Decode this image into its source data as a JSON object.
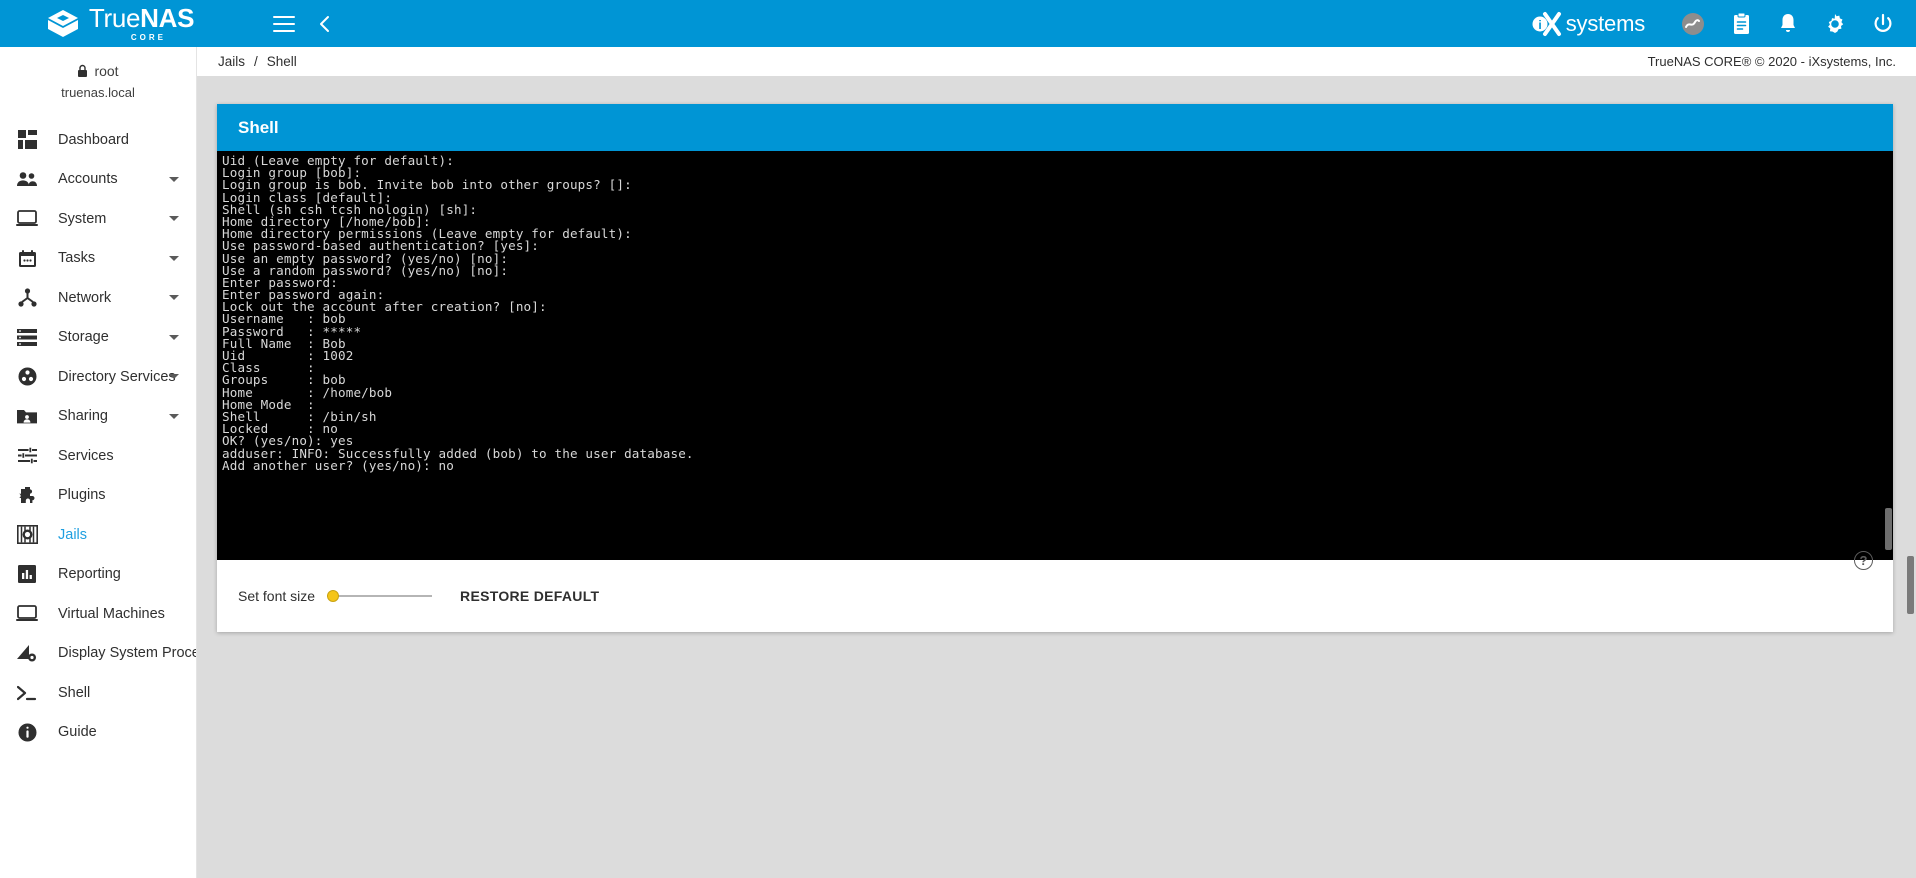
{
  "topbar": {
    "brand_true": "True",
    "brand_nas": "NAS",
    "brand_sub": "CORE",
    "menu_icon": "hamburger-menu-icon",
    "back_icon": "chevron-left-icon",
    "ix_word": "systems",
    "icons": [
      {
        "name": "truenas-status-icon",
        "glyph": "◔"
      },
      {
        "name": "clipboard-tasks-icon",
        "glyph": "ὌB"
      },
      {
        "name": "notifications-bell-icon",
        "glyph": "ὑ4"
      },
      {
        "name": "settings-gear-icon",
        "glyph": "⚙"
      },
      {
        "name": "power-icon",
        "glyph": "⏻"
      }
    ]
  },
  "breadcrumb": {
    "items": [
      "Jails",
      "Shell"
    ],
    "separator": "/",
    "copyright": "TrueNAS CORE® © 2020 - iXsystems, Inc."
  },
  "sidebar": {
    "user": "root",
    "hostname": "truenas.local",
    "lock_icon": "lock-icon",
    "items": [
      {
        "label": "Dashboard",
        "icon": "dashboard-icon",
        "expandable": false,
        "active": false
      },
      {
        "label": "Accounts",
        "icon": "accounts-people-icon",
        "expandable": true,
        "active": false
      },
      {
        "label": "System",
        "icon": "system-monitor-icon",
        "expandable": true,
        "active": false
      },
      {
        "label": "Tasks",
        "icon": "tasks-calendar-icon",
        "expandable": true,
        "active": false
      },
      {
        "label": "Network",
        "icon": "network-icon",
        "expandable": true,
        "active": false
      },
      {
        "label": "Storage",
        "icon": "storage-disks-icon",
        "expandable": true,
        "active": false
      },
      {
        "label": "Directory Services",
        "icon": "directory-services-icon",
        "expandable": true,
        "active": false
      },
      {
        "label": "Sharing",
        "icon": "sharing-folder-icon",
        "expandable": true,
        "active": false
      },
      {
        "label": "Services",
        "icon": "services-sliders-icon",
        "expandable": false,
        "active": false
      },
      {
        "label": "Plugins",
        "icon": "plugins-puzzle-icon",
        "expandable": false,
        "active": false
      },
      {
        "label": "Jails",
        "icon": "jails-icon",
        "expandable": false,
        "active": true
      },
      {
        "label": "Reporting",
        "icon": "reporting-chart-icon",
        "expandable": false,
        "active": false
      },
      {
        "label": "Virtual Machines",
        "icon": "virtual-machines-icon",
        "expandable": false,
        "active": false
      },
      {
        "label": "Display System Processes",
        "icon": "system-processes-icon",
        "expandable": false,
        "active": false
      },
      {
        "label": "Shell",
        "icon": "shell-prompt-icon",
        "expandable": false,
        "active": false
      },
      {
        "label": "Guide",
        "icon": "guide-info-icon",
        "expandable": false,
        "active": false
      }
    ]
  },
  "shell_card": {
    "title": "Shell",
    "terminal_lines": [
      "Uid (Leave empty for default):",
      "Login group [bob]:",
      "Login group is bob. Invite bob into other groups? []:",
      "Login class [default]:",
      "Shell (sh csh tcsh nologin) [sh]:",
      "Home directory [/home/bob]:",
      "Home directory permissions (Leave empty for default):",
      "Use password-based authentication? [yes]:",
      "Use an empty password? (yes/no) [no]:",
      "Use a random password? (yes/no) [no]:",
      "Enter password:",
      "Enter password again:",
      "Lock out the account after creation? [no]:",
      "Username   : bob",
      "Password   : *****",
      "Full Name  : Bob",
      "Uid        : 1002",
      "Class      :",
      "Groups     : bob",
      "Home       : /home/bob",
      "Home Mode  :",
      "Shell      : /bin/sh",
      "Locked     : no",
      "OK? (yes/no): yes",
      "adduser: INFO: Successfully added (bob) to the user database.",
      "Add another user? (yes/no): no"
    ],
    "footer": {
      "font_size_label": "Set font size",
      "restore_label": "RESTORE DEFAULT",
      "help_glyph": "?"
    }
  },
  "colors": {
    "accent": "#0095d5",
    "active_nav": "#1f9fe0",
    "slider_thumb": "#f5c518",
    "terminal_bg": "#000000",
    "terminal_text": "#d8d8d8",
    "page_bg": "#dcdcdc"
  }
}
